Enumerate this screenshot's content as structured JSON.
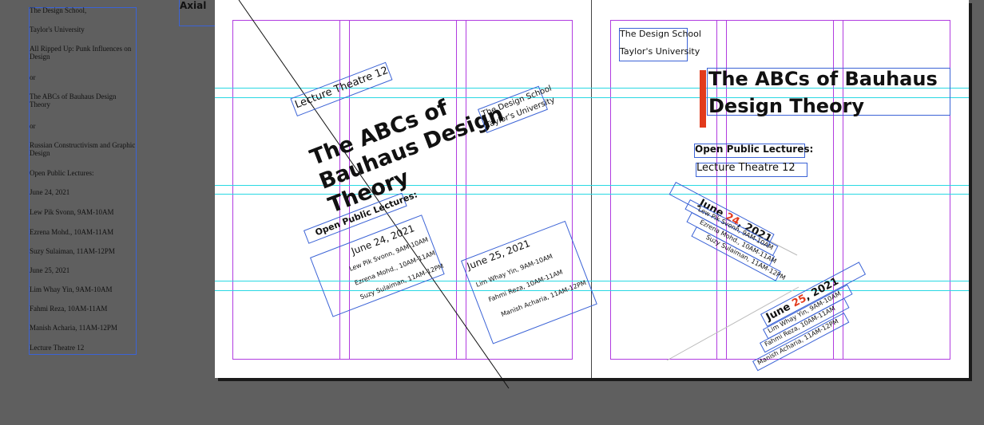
{
  "pasteboard": {
    "lines": [
      "The Design School,",
      "Taylor's University",
      "All Ripped Up: Punk Influences on Design",
      "or",
      "The ABCs of Bauhaus Design Theory",
      "or",
      "Russian Constructivism and Graphic Design",
      "Open Public Lectures:",
      "June 24, 2021",
      "Lew Pik Svonn, 9AM-10AM",
      "Ezrena Mohd., 10AM-11AM",
      "Suzy Sulaiman, 11AM-12PM",
      "June 25, 2021",
      "Lim Whay Yin, 9AM-10AM",
      "Fahmi Reza, 10AM-11AM",
      "Manish Acharia, 11AM-12PM",
      "Lecture Theatre 12"
    ]
  },
  "left_page": {
    "label": "Axial",
    "lecture_hall": "Lecture Theatre 12",
    "title": "The ABCs of Bauhaus Design Theory",
    "school_line1": "The Design School",
    "school_line2": "Taylor's University",
    "lectures_heading": "Open Public Lectures:",
    "day1": "June 24, 2021",
    "day1_items": [
      "Lew Pik Svonn, 9AM-10AM",
      "Ezrena Mohd., 10AM-11AM",
      "Suzy Sulaiman, 11AM-12PM"
    ],
    "day2": "June 25, 2021",
    "day2_items": [
      "Lim Whay Yin, 9AM-10AM",
      "Fahmi Reza, 10AM-11AM",
      "Manish Acharia, 11AM-12PM"
    ]
  },
  "right_page": {
    "school_line1": "The Design School",
    "school_line2": "Taylor's University",
    "title_line1": "The ABCs of Bauhaus",
    "title_line2": "Design Theory",
    "lectures_heading": "Open Public Lectures:",
    "lecture_hall": "Lecture Theatre 12",
    "day1_prefix": "June ",
    "day1_num": "24",
    "day1_suffix": ", 2021",
    "day1_items": [
      "Lew Pik Svonn, 9AM-10AM",
      "Ezrena Mohd., 10AM-11AM",
      "Suzy Sulaiman, 11AM-12PM"
    ],
    "day2_prefix": "June ",
    "day2_num": "25",
    "day2_suffix": ", 2021",
    "day2_items": [
      "Lim Whay Yin, 9AM-10AM",
      "Fahmi Reza, 10AM-11AM",
      "Manish Acharia, 11AM-12PM"
    ]
  },
  "colors": {
    "accent": "#e23a1c",
    "guide": "#29d8e3",
    "margin": "#b13ce0",
    "frame": "#3b63d6"
  }
}
